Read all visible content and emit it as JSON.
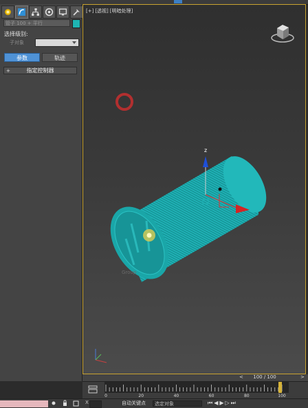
{
  "command_panel": {
    "tabs": [
      "create-icon",
      "modify-icon",
      "hierarchy-icon",
      "motion-icon",
      "display-icon",
      "utilities-icon"
    ],
    "object_name": "管子 100 + 平行",
    "object_color": "#1fb5b3",
    "selection_level_label": "选择级别:",
    "sub_object_label": "子对象",
    "sub_object_value": "",
    "params_button": "参数",
    "trajectories_button": "轨迹",
    "rollout_plus": "+",
    "rollout_title": "指定控制器"
  },
  "viewport": {
    "label_plus": "[+]",
    "label_view": "[透视]",
    "label_shading": "[明暗处理]",
    "gizmo_z_label": "z",
    "faint_label": "Group"
  },
  "timeline": {
    "range_text": "100 / 100",
    "left_arrow": "<",
    "right_arrow": ">",
    "tick_labels": [
      "0",
      "20",
      "40",
      "60",
      "80",
      "100"
    ]
  },
  "status_bar": {
    "x_label": "X",
    "auto_key_label": "自动关键点",
    "selection_dropdown": "选定对象"
  },
  "colors": {
    "accent": "#4f92d6",
    "viewport_border": "#c9a330",
    "mesh": "#20b3b6"
  }
}
